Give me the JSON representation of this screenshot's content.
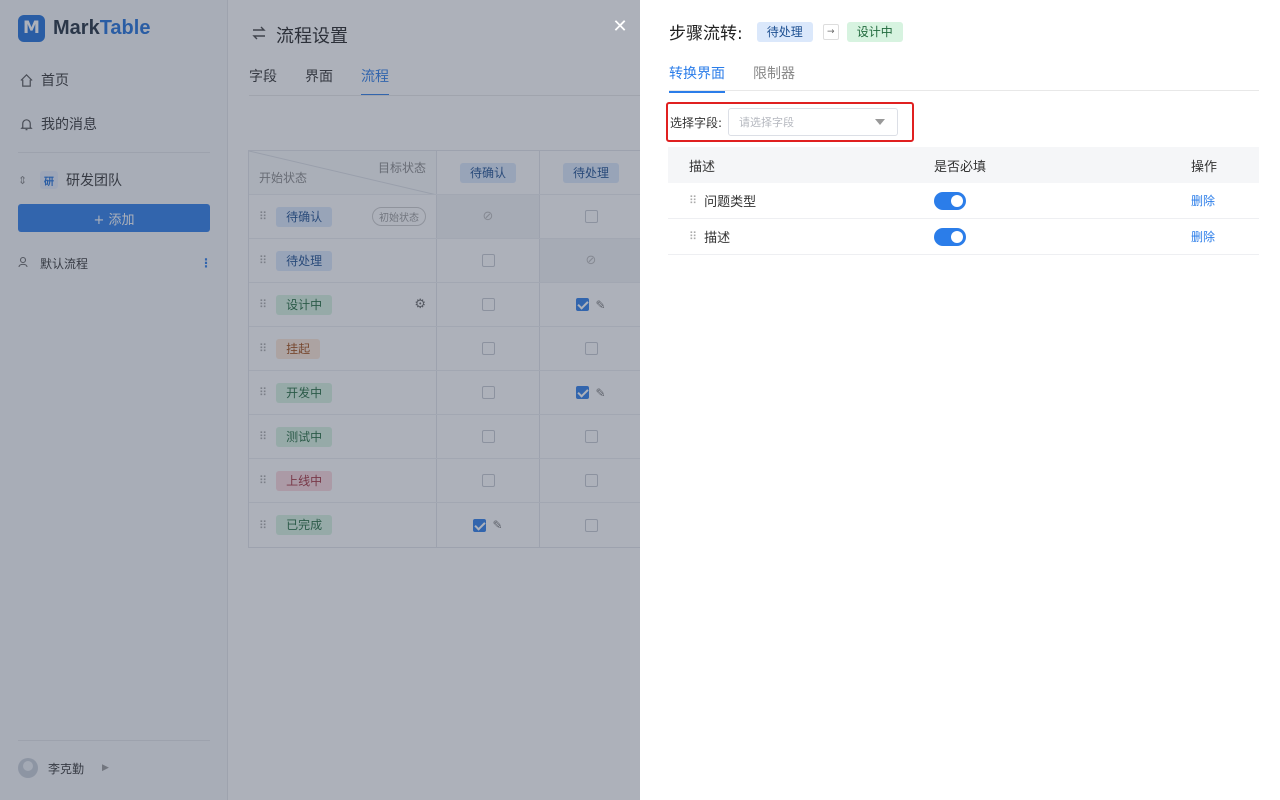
{
  "app": {
    "logo_letter": "M",
    "logo_prefix": "Mark",
    "logo_suffix": "Table"
  },
  "sidebar": {
    "nav": [
      {
        "label": "首页",
        "icon": "home-icon"
      },
      {
        "label": "我的消息",
        "icon": "bell-icon"
      }
    ],
    "team": {
      "badge": "研",
      "name": "研发团队"
    },
    "add_label": "+ 添加",
    "flow_item": "默认流程",
    "user_name": "李克勤"
  },
  "page": {
    "title": "流程设置",
    "tabs": [
      "字段",
      "界面",
      "流程"
    ],
    "active_tab": "流程"
  },
  "matrix": {
    "corner_target": "目标状态",
    "corner_source": "开始状态",
    "columns": [
      {
        "label": "待确认",
        "color": "blue"
      },
      {
        "label": "待处理",
        "color": "blue"
      }
    ],
    "rows": [
      {
        "label": "待确认",
        "color": "blue",
        "initial": "初始状态",
        "cells": [
          "ban",
          "off"
        ]
      },
      {
        "label": "待处理",
        "color": "blue",
        "cells": [
          "off",
          "ban"
        ]
      },
      {
        "label": "设计中",
        "color": "green",
        "gear": true,
        "cells": [
          "off",
          "on"
        ]
      },
      {
        "label": "挂起",
        "color": "orange",
        "cells": [
          "off",
          "off"
        ]
      },
      {
        "label": "开发中",
        "color": "green",
        "cells": [
          "off",
          "on"
        ]
      },
      {
        "label": "测试中",
        "color": "green",
        "cells": [
          "off",
          "off"
        ]
      },
      {
        "label": "上线中",
        "color": "red",
        "cells": [
          "off",
          "off"
        ]
      },
      {
        "label": "已完成",
        "color": "green",
        "cells": [
          "on",
          "off"
        ]
      }
    ]
  },
  "drawer": {
    "title": "步骤流转:",
    "from_status": "待处理",
    "arrow": "→",
    "to_status": "设计中",
    "tabs": [
      "转换界面",
      "限制器"
    ],
    "active_tab": "转换界面",
    "field_label": "选择字段:",
    "field_placeholder": "请选择字段",
    "table": {
      "headers": [
        "描述",
        "是否必填",
        "操作"
      ],
      "rows": [
        {
          "name": "问题类型",
          "required": true,
          "action": "删除"
        },
        {
          "name": "描述",
          "required": true,
          "action": "删除"
        }
      ]
    }
  },
  "colors": {
    "accent": "#2b7de9",
    "highlight_border": "#e02020"
  }
}
